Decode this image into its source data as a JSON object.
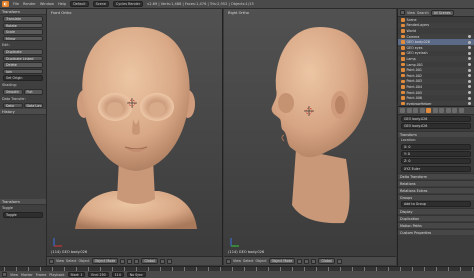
{
  "topbar": {
    "menus": [
      "File",
      "Render",
      "Window",
      "Help"
    ],
    "layout": "Default",
    "scene": "Scene",
    "engine": "Cycles Render",
    "stats": "v2.69 | Verts:1,488 | Faces:1,476 | Tris:2,952 | Objects:1/15"
  },
  "toolshelf": {
    "transform_hdr": "Transform",
    "transform_btns": [
      "Translate",
      "Rotate",
      "Scale",
      "Mirror"
    ],
    "edit_label": "Edit:",
    "edit_btns": [
      "Duplicate",
      "Duplicate Linked",
      "Delete",
      "Join"
    ],
    "set_origin": "Set Origin",
    "shading_label": "Shading:",
    "smooth": "Smooth",
    "flat": "Flat",
    "history_label": "Data Transfer:",
    "history_btns": [
      "Data",
      "Data Layout"
    ],
    "history_hdr": "History",
    "operator_hdr": "Transform",
    "toggle_label": "Toggle",
    "toggle_value": "Toggle"
  },
  "viewports": {
    "front": {
      "label": "Front Ortho",
      "object": "(114) GEO body.026"
    },
    "right": {
      "label": "Right Ortho",
      "object": "(114) GEO body.026"
    },
    "header": {
      "items": [
        "View",
        "Select",
        "Object"
      ],
      "mode": "Object Mode",
      "pivot": "Global"
    }
  },
  "outliner": {
    "view": "View",
    "search": "Search",
    "scenes": "All Scenes",
    "rows": [
      "Scene",
      "RenderLayers",
      "World",
      "Camera",
      "GEO body.026",
      "GEO eyes",
      "GEO eyelash",
      "Lamp",
      "Lamp.001",
      "Point.001",
      "Point.002",
      "Point.003",
      "Point.004",
      "Point.005",
      "Point.006",
      "eyebrowHelper"
    ]
  },
  "props": {
    "object_path": "GEO body.026",
    "object_name": "GEO body.026",
    "relations_hdr": "Relations",
    "transform_hdr": "Transform",
    "location": "Location:",
    "loc_vals": [
      "X: 0",
      "Y: 0",
      "Z: 0"
    ],
    "delta_hdr": "Delta Transform",
    "relations_hdr2": "Relations Extras",
    "groups_hdr": "Groups",
    "add_to_group": "Add to Group",
    "display_hdr": "Display",
    "duplication_hdr": "Duplication",
    "motion_hdr": "Motion Paths",
    "custom_hdr": "Custom Properties",
    "mode": "XYZ Euler"
  },
  "timeline": {
    "items": [
      "View",
      "Marker",
      "Frame",
      "Playback"
    ],
    "start": "Start: 1",
    "end": "End: 250",
    "current": "114",
    "sync": "No Sync"
  }
}
